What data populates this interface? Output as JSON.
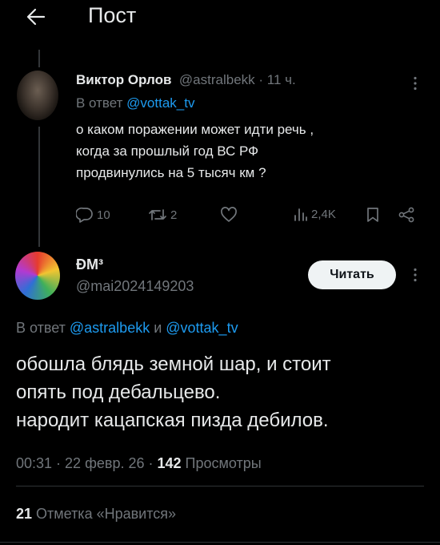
{
  "header": {
    "title": "Пост",
    "back_icon": "arrow-left-icon"
  },
  "reply": {
    "author_name": "Виктор Орлов",
    "handle": "@astralbekk",
    "separator": " · ",
    "time": "11 ч.",
    "reply_prefix": "В ответ ",
    "reply_to": "@vottak_tv",
    "text_lines": [
      "о каком поражении может идти речь ,",
      "когда за прошлый год ВС РФ",
      "продвинулись на 5 тысяч км ?"
    ],
    "actions": {
      "replies": "10",
      "reposts": "2",
      "likes": "",
      "views": "2,4K"
    }
  },
  "main": {
    "author_name": "ÐМ³",
    "handle": "@mai2024149203",
    "follow_label": "Читать",
    "reply_prefix": "В ответ ",
    "reply_to_1": "@astralbekk",
    "reply_and": " и ",
    "reply_to_2": "@vottak_tv",
    "text_lines": [
      "обошла блядь земной шар, и стоит",
      "опять под дебальцево.",
      "народит кацапская пизда дебилов."
    ],
    "time": "00:31",
    "dot": " · ",
    "date": "22 февр. 26",
    "views_count": "142",
    "views_label": " Просмотры",
    "likes_count": "21",
    "likes_label": " Отметка «Нравится»"
  },
  "colors": {
    "background": "#000000",
    "text": "#e7e9ea",
    "muted": "#71767b",
    "link": "#1d9bf0"
  }
}
